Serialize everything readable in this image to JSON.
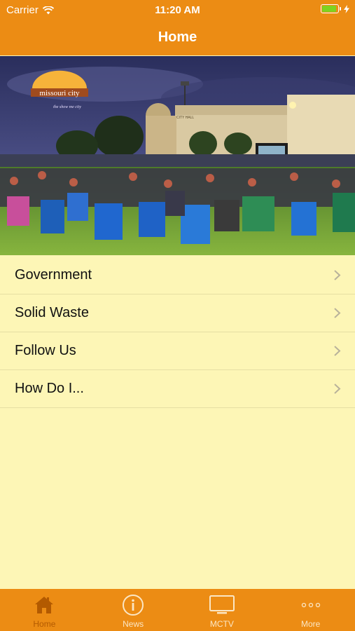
{
  "status_bar": {
    "carrier": "Carrier",
    "time": "11:20 AM",
    "battery_level": 0.85
  },
  "nav": {
    "title": "Home"
  },
  "hero": {
    "logo_text": "missouri city",
    "logo_tagline": "the show me city",
    "building_sign": "CITY HALL"
  },
  "menu": {
    "items": [
      {
        "label": "Government"
      },
      {
        "label": "Solid Waste"
      },
      {
        "label": "Follow Us"
      },
      {
        "label": "How Do I..."
      }
    ]
  },
  "tabs": [
    {
      "label": "Home",
      "icon": "house-icon",
      "active": true
    },
    {
      "label": "News",
      "icon": "info-icon",
      "active": false
    },
    {
      "label": "MCTV",
      "icon": "tv-icon",
      "active": false
    },
    {
      "label": "More",
      "icon": "more-dots-icon",
      "active": false
    }
  ],
  "colors": {
    "accent": "#ec8c14",
    "background": "#fdf6b6",
    "active_tab": "#b35a00"
  }
}
